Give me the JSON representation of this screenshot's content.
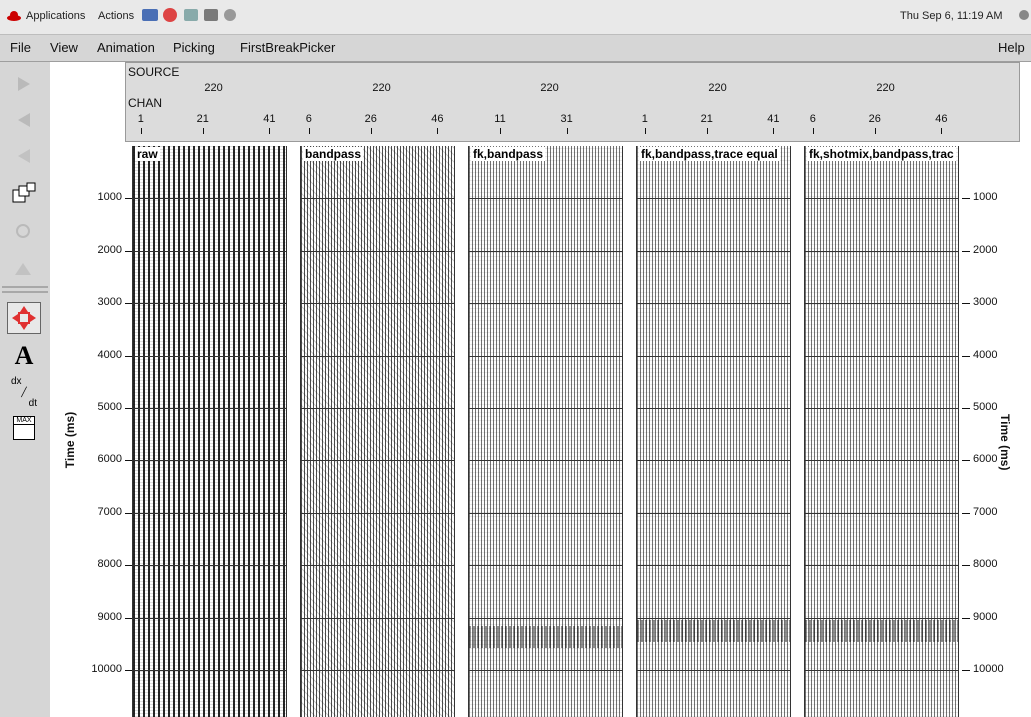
{
  "topbar": {
    "apps_menu": "Applications",
    "actions_menu": "Actions",
    "clock": "Thu Sep  6, 11:19 AM"
  },
  "menubar": {
    "items": [
      "File",
      "View",
      "Animation",
      "Picking",
      "FirstBreakPicker"
    ],
    "help": "Help"
  },
  "toolbar": {
    "text_tool_glyph": "A",
    "derivative_glyph_top": "dx",
    "derivative_glyph_bottom": "dt",
    "max_glyph": "MAX"
  },
  "header": {
    "source_label": "SOURCE",
    "chan_label": "CHAN",
    "source_values": [
      "220",
      "220",
      "220",
      "220",
      "220"
    ],
    "chan_ticks": [
      [
        "1",
        "21",
        "41"
      ],
      [
        "6",
        "26",
        "46"
      ],
      [
        "11",
        "31"
      ],
      [
        "1",
        "21",
        "41"
      ],
      [
        "6",
        "26",
        "46"
      ]
    ]
  },
  "panels": [
    {
      "title": "raw"
    },
    {
      "title": "bandpass"
    },
    {
      "title": "fk,bandpass"
    },
    {
      "title": "fk,bandpass,trace equal"
    },
    {
      "title": "fk,shotmix,bandpass,trac"
    }
  ],
  "y_axis": {
    "title": "Time (ms)",
    "ticks": [
      "1000",
      "2000",
      "3000",
      "4000",
      "5000",
      "6000",
      "7000",
      "8000",
      "9000",
      "10000"
    ],
    "tick_values": [
      1000,
      2000,
      3000,
      4000,
      5000,
      6000,
      7000,
      8000,
      9000,
      10000
    ]
  }
}
